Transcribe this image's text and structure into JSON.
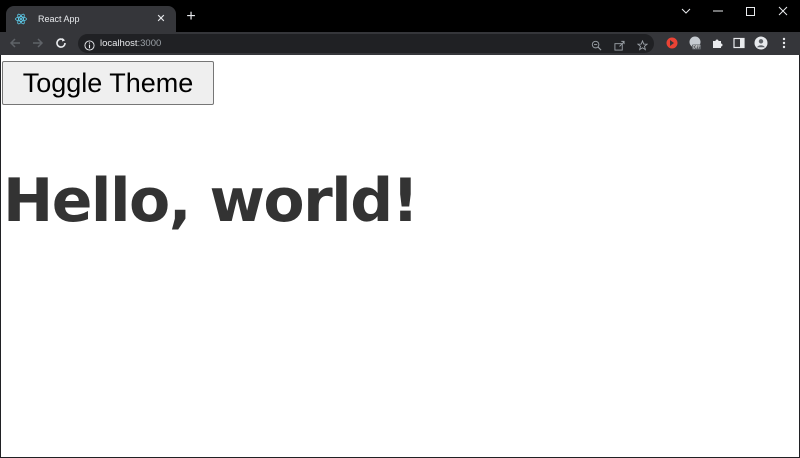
{
  "browser": {
    "tab": {
      "title": "React App",
      "favicon": "react-logo-icon"
    },
    "omnibox": {
      "host": "localhost",
      "port": ":3000"
    },
    "toolbar_icons": [
      "back-icon",
      "forward-icon",
      "reload-icon",
      "info-icon",
      "zoom-icon",
      "share-icon",
      "star-icon",
      "extension-icon",
      "extension-badge-icon",
      "puzzle-icon",
      "side-panel-icon",
      "profile-icon",
      "menu-icon"
    ]
  },
  "page": {
    "toggle_label": "Toggle Theme",
    "heading": "Hello, world!",
    "background": "#ffffff",
    "text_color": "#333333"
  }
}
